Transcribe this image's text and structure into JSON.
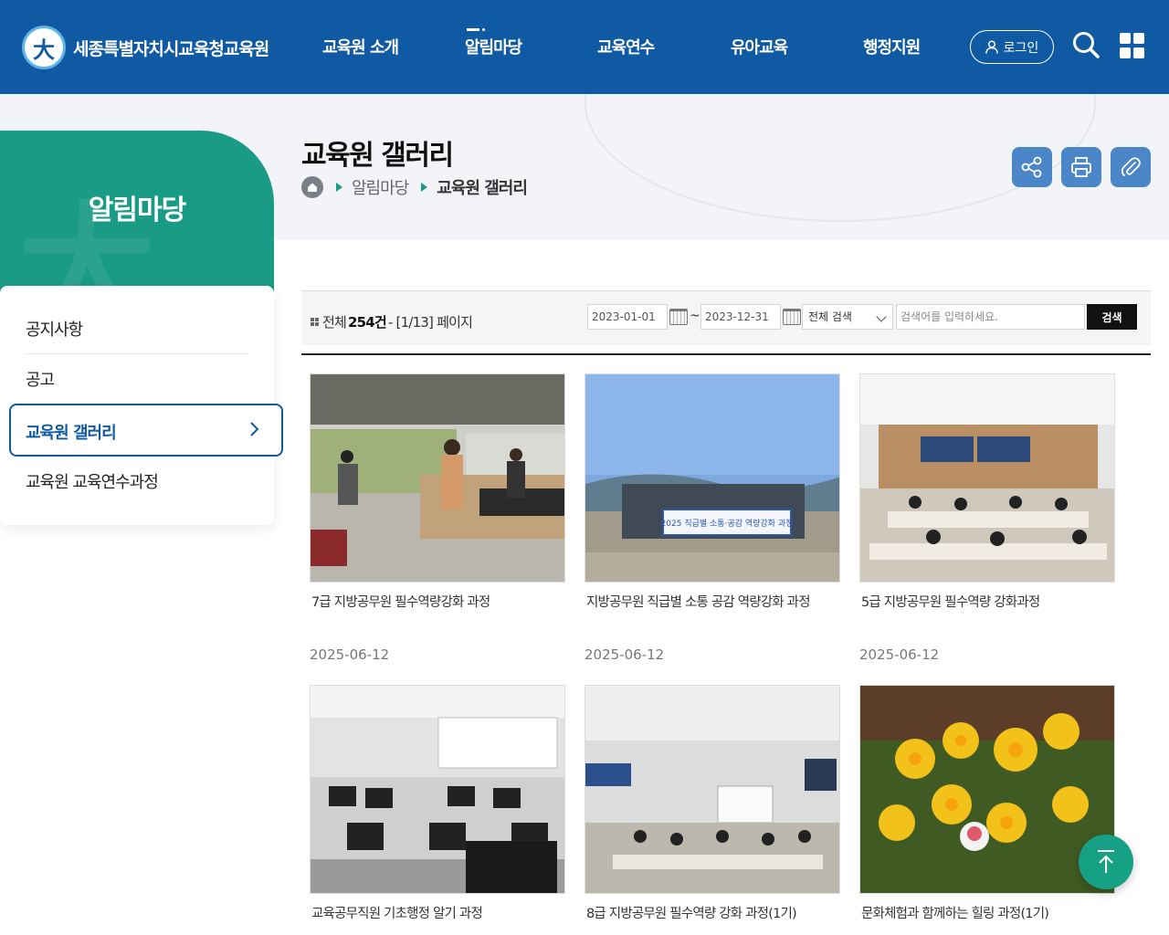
{
  "header": {
    "site_name": "세종특별자치시교육청교육원",
    "logo_glyph": "大",
    "nav": [
      "교육원 소개",
      "알림마당",
      "교육연수",
      "유아교육",
      "행정지원"
    ],
    "active_nav": "알림마당",
    "login_label": "로그인",
    "brand_color": "#0f5aa3"
  },
  "sidebar": {
    "title": "알림마당",
    "items": [
      "공지사항",
      "공고",
      "교육원 갤러리",
      "교육원 교육연수과정"
    ],
    "active_item": "교육원 갤러리",
    "accent_color": "#1a9b85"
  },
  "page": {
    "title": "교육원 갤러리",
    "breadcrumb": [
      "알림마당",
      "교육원 갤러리"
    ],
    "tools": [
      "share-icon",
      "print-icon",
      "attach-icon"
    ]
  },
  "search": {
    "total_prefix": "전체",
    "total_count": "254건",
    "page_info": "- [1/13] 페이지",
    "date_from": "2023-01-01",
    "date_sep": "~",
    "date_to": "2023-12-31",
    "scope": "전체 검색",
    "keyword_placeholder": "검색어를 입력하세요.",
    "submit_label": "검색"
  },
  "gallery": [
    {
      "title": "7급 지방공무원 필수역량강화 과정",
      "date": "2025-06-12"
    },
    {
      "title": "지방공무원 직급별 소통 공감 역량강화 과정",
      "date": "2025-06-12",
      "banner": "2025 직급별 소통·공감 역량강화 과정"
    },
    {
      "title": "5급 지방공무원 필수역량 강화과정",
      "date": "2025-06-12"
    },
    {
      "title": "교육공무직원 기초행정 알기 과정",
      "date": ""
    },
    {
      "title": "8급 지방공무원 필수역량 강화 과정(1기)",
      "date": ""
    },
    {
      "title": "문화체험과 함께하는 힐링 과정(1기)",
      "date": ""
    }
  ]
}
